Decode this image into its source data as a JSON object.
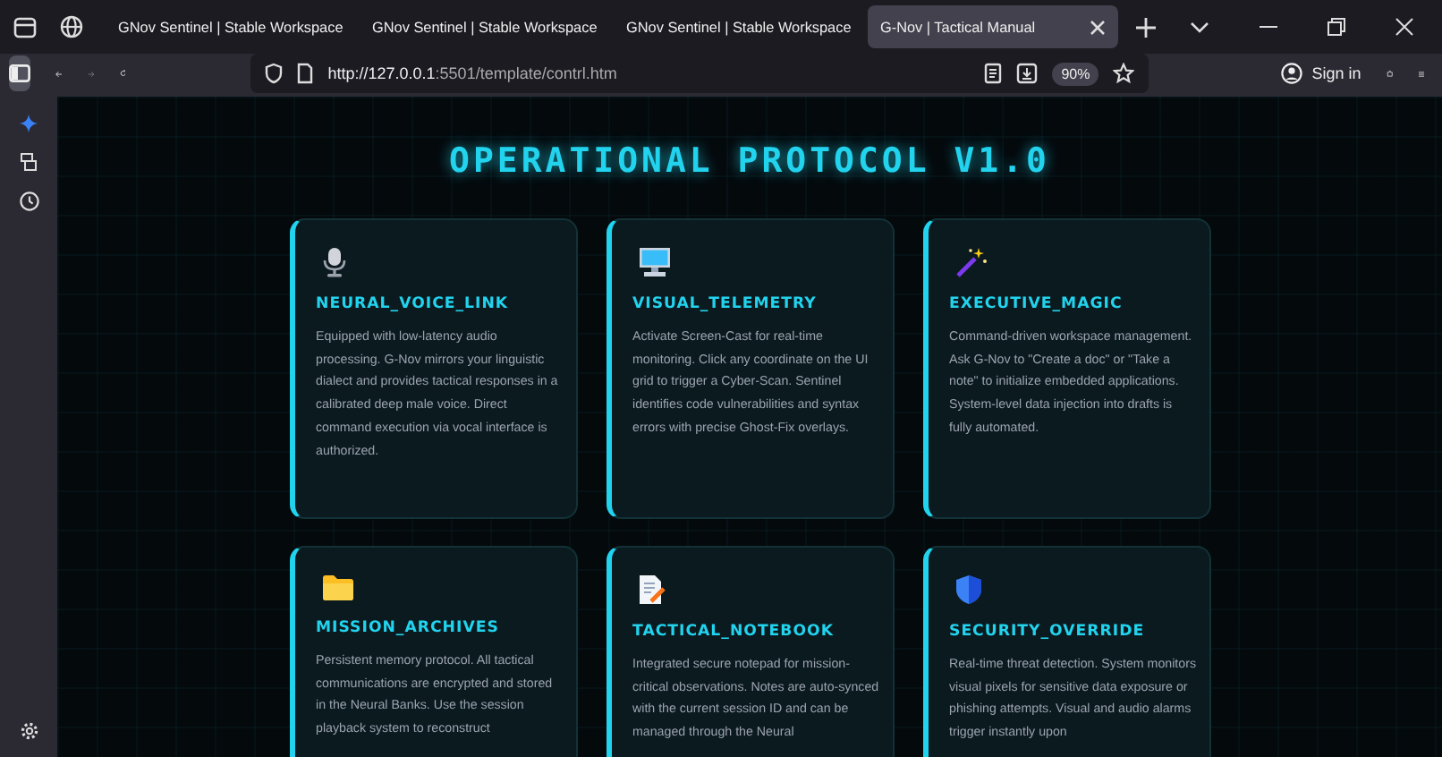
{
  "tabs": [
    {
      "title": "GNov Sentinel | Stable Workspace",
      "selected": false
    },
    {
      "title": "GNov Sentinel | Stable Workspace",
      "selected": false
    },
    {
      "title": "GNov Sentinel | Stable Workspace",
      "selected": false
    },
    {
      "title": "G-Nov | Tactical Manual",
      "selected": true
    }
  ],
  "toolbar": {
    "url_host": "http://127.0.0.1",
    "url_rest": ":5501/template/contrl.htm",
    "zoom": "90%",
    "sign_in": "Sign in"
  },
  "page": {
    "title": "OPERATIONAL PROTOCOL V1.0",
    "cards": [
      {
        "kind": "microphone",
        "title": "NEURAL_VOICE_LINK",
        "text": "Equipped with low-latency audio processing. G-Nov mirrors your linguistic dialect and provides tactical responses in a calibrated deep male voice. Direct command execution via vocal interface is authorized."
      },
      {
        "kind": "monitor",
        "title": "VISUAL_TELEMETRY",
        "text": "Activate Screen-Cast for real-time monitoring. Click any coordinate on the UI grid to trigger a Cyber-Scan. Sentinel identifies code vulnerabilities and syntax errors with precise Ghost-Fix overlays."
      },
      {
        "kind": "wand",
        "title": "EXECUTIVE_MAGIC",
        "text": "Command-driven workspace management. Ask G-Nov to \"Create a doc\" or \"Take a note\" to initialize embedded applications. System-level data injection into drafts is fully automated."
      },
      {
        "kind": "folder",
        "title": "MISSION_ARCHIVES",
        "text": "Persistent memory protocol. All tactical communications are encrypted and stored in the Neural Banks. Use the session playback system to reconstruct"
      },
      {
        "kind": "memo",
        "title": "TACTICAL_NOTEBOOK",
        "text": "Integrated secure notepad for mission-critical observations. Notes are auto-synced with the current session ID and can be managed through the Neural"
      },
      {
        "kind": "shield",
        "title": "SECURITY_OVERRIDE",
        "text": "Real-time threat detection. System monitors visual pixels for sensitive data exposure or phishing attempts. Visual and audio alarms trigger instantly upon"
      }
    ]
  }
}
